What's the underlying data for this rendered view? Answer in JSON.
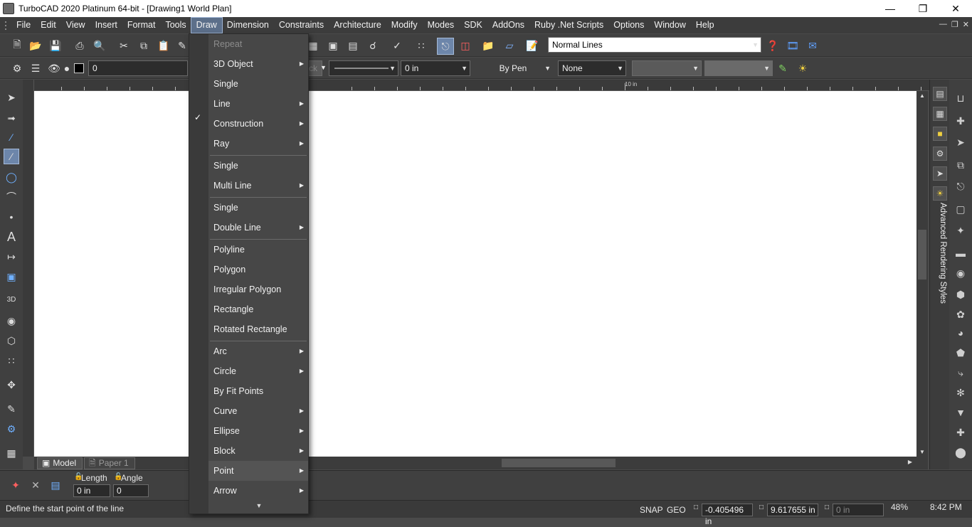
{
  "window": {
    "title": "TurboCAD 2020 Platinum 64-bit - [Drawing1 World Plan]"
  },
  "menubar": {
    "items": [
      "File",
      "Edit",
      "View",
      "Insert",
      "Format",
      "Tools",
      "Draw",
      "Dimension",
      "Constraints",
      "Architecture",
      "Modify",
      "Modes",
      "SDK",
      "AddOns",
      "Ruby .Net Scripts",
      "Options",
      "Window",
      "Help"
    ],
    "active": "Draw"
  },
  "toolbar": {
    "line_style_combo": "Normal Lines",
    "layer_value": "0",
    "color_value": "Black",
    "width_value": "0 in",
    "pen_value": "By Pen",
    "fill_value": "None"
  },
  "ruler": {
    "label_10in": "10 in"
  },
  "draw_menu": {
    "items": [
      {
        "label": "Repeat",
        "disabled": true,
        "submenu": false
      },
      {
        "label": "3D Object",
        "disabled": false,
        "submenu": true
      },
      {
        "label": "Single",
        "disabled": false,
        "submenu": false,
        "checked": true
      },
      {
        "label": "Line",
        "disabled": false,
        "submenu": true
      },
      {
        "label": "Construction",
        "disabled": false,
        "submenu": true
      },
      {
        "label": "Ray",
        "disabled": false,
        "submenu": true
      },
      {
        "label": "Single",
        "disabled": false,
        "submenu": false
      },
      {
        "label": "Multi Line",
        "disabled": false,
        "submenu": true
      },
      {
        "label": "Single",
        "disabled": false,
        "submenu": false
      },
      {
        "label": "Double Line",
        "disabled": false,
        "submenu": true
      },
      {
        "label": "Polyline",
        "disabled": false,
        "submenu": false
      },
      {
        "label": "Polygon",
        "disabled": false,
        "submenu": false
      },
      {
        "label": "Irregular Polygon",
        "disabled": false,
        "submenu": false
      },
      {
        "label": "Rectangle",
        "disabled": false,
        "submenu": false
      },
      {
        "label": "Rotated Rectangle",
        "disabled": false,
        "submenu": false
      },
      {
        "label": "Arc",
        "disabled": false,
        "submenu": true
      },
      {
        "label": "Circle",
        "disabled": false,
        "submenu": true
      },
      {
        "label": "By Fit Points",
        "disabled": false,
        "submenu": false
      },
      {
        "label": "Curve",
        "disabled": false,
        "submenu": true
      },
      {
        "label": "Ellipse",
        "disabled": false,
        "submenu": true
      },
      {
        "label": "Block",
        "disabled": false,
        "submenu": true
      },
      {
        "label": "Point",
        "disabled": false,
        "submenu": true
      },
      {
        "label": "Arrow",
        "disabled": false,
        "submenu": true
      }
    ]
  },
  "tabs": {
    "model": "Model",
    "paper": "Paper 1"
  },
  "side_panel": {
    "vertical_title": "Advanced Rendering Styles"
  },
  "inspector": {
    "length_label": "Length",
    "angle_label": "Angle",
    "length_value": "0 in",
    "angle_value": "0"
  },
  "status": {
    "prompt": "Define the start point of the line",
    "snap": "SNAP",
    "geo": "GEO",
    "x_value": "-0.405496 in",
    "y_value": "9.617655 in",
    "z_value": "0 in",
    "zoom": "48%",
    "time": "8:42 PM"
  },
  "accent_color": "#6d86aa"
}
